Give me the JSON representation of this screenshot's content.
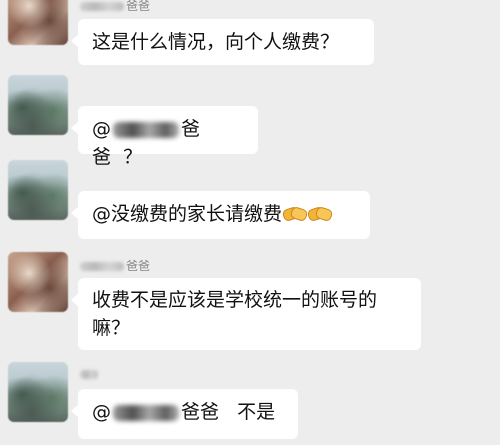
{
  "chat": {
    "messages": [
      {
        "sender_suffix": "爸爸",
        "text": "这是什么情况，向个人缴费？"
      },
      {
        "mention_prefix": "@",
        "mention_suffix": "爸爸",
        "text": "？"
      },
      {
        "text": "@没缴费的家长请缴费",
        "emoji": "handshake-icon"
      },
      {
        "sender_suffix": "爸爸",
        "line1": "收费不是应该是学校统一的账号的",
        "line2": "嘛？"
      },
      {
        "mention_prefix": "@",
        "mention_suffix": "爸爸",
        "text": "不是"
      }
    ]
  },
  "colors": {
    "background": "#ededed",
    "bubble": "#ffffff",
    "text": "#111111",
    "name": "#888888"
  }
}
